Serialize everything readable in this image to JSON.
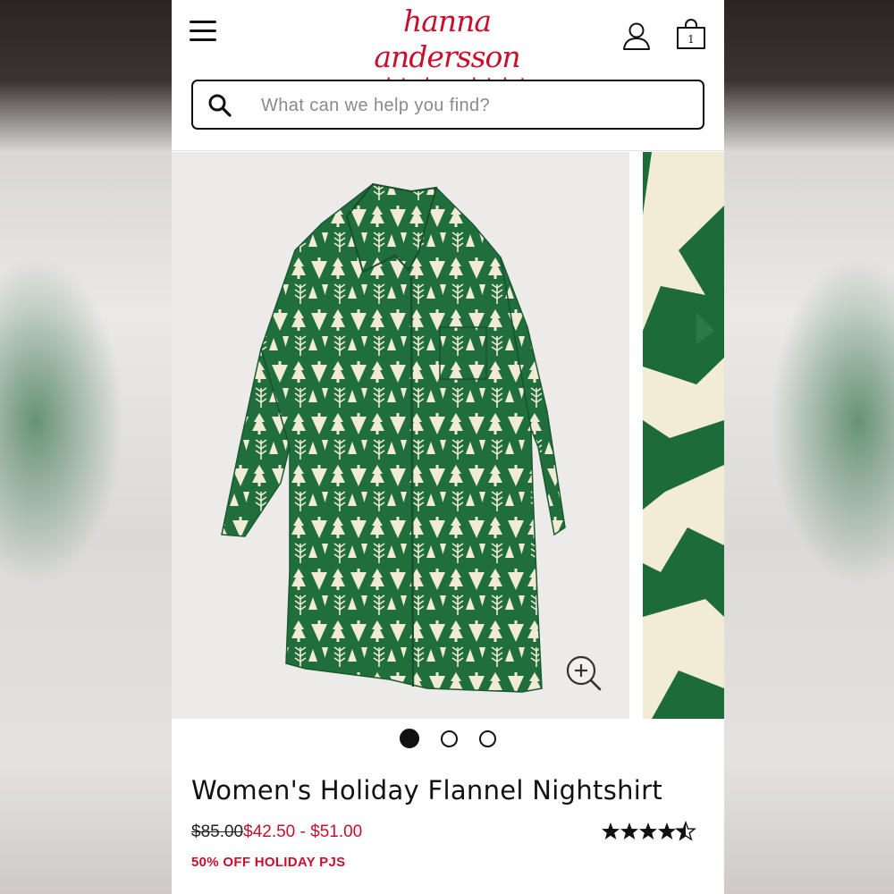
{
  "header": {
    "logo_text": "hanna andersson",
    "tagline": "made to play. made to last.",
    "bag_count": "1"
  },
  "search": {
    "placeholder": "What can we help you find?"
  },
  "gallery": {
    "image_count": 3,
    "active_index": 0
  },
  "product": {
    "title": "Women's Holiday Flannel Nightshirt",
    "price_original": "$85.00",
    "price_sale": "$42.50 - $51.00",
    "promo": "50% OFF HOLIDAY PJS",
    "rating": 4.5
  },
  "colors": {
    "brand_red": "#c8102e",
    "print_green": "#1d6b3a",
    "print_cream": "#f3ecd6"
  }
}
